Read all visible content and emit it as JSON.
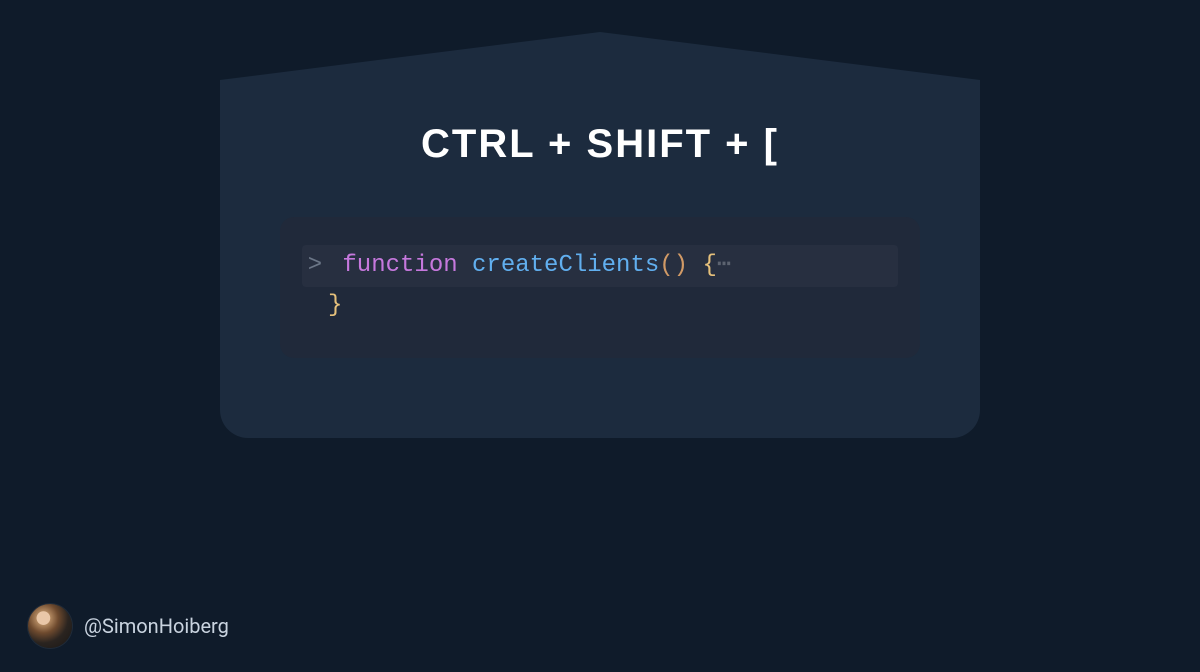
{
  "title": "CTRL + SHIFT + [",
  "code": {
    "gutter": ">",
    "keyword": "function",
    "funcName": "createClients",
    "parens": "()",
    "openBrace": "{",
    "ellipsis": "⋯",
    "closeBrace": "}"
  },
  "author": {
    "handle": "@SimonHoiberg"
  }
}
